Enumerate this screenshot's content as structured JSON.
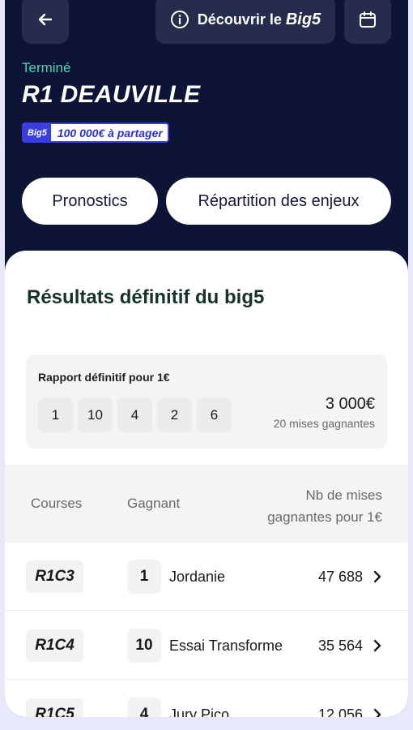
{
  "header": {
    "discover_label": "Découvrir le",
    "discover_brand": "Big5",
    "status": "Terminé",
    "race_title": "R1 DEAUVILLE",
    "jackpot_logo": "Big5",
    "jackpot_amount": "100 000€ à partager"
  },
  "tabs": [
    {
      "label": "Pronostics"
    },
    {
      "label": "Répartition des enjeux"
    }
  ],
  "results": {
    "title": "Résultats définitif du big5",
    "report_label": "Rapport définitif pour 1€",
    "numbers": [
      "1",
      "10",
      "4",
      "2",
      "6"
    ],
    "amount": "3 000€",
    "winning_bets": "20 mises gagnantes"
  },
  "table": {
    "col_courses": "Courses",
    "col_gagnant": "Gagnant",
    "col_mises_line1": "Nb de mises",
    "col_mises_line2": "gagnantes pour 1€",
    "rows": [
      {
        "course": "R1C3",
        "num": "1",
        "horse": "Jordanie",
        "mises": "47 688"
      },
      {
        "course": "R1C4",
        "num": "10",
        "horse": "Essai Transforme",
        "mises": "35 564"
      },
      {
        "course": "R1C5",
        "num": "4",
        "horse": "Jury Pico",
        "mises": "12 056"
      }
    ]
  },
  "icons": {
    "back": "arrow-left-icon",
    "info": "info-circle-icon",
    "calendar": "calendar-icon",
    "chevron": "chevron-right-icon"
  },
  "colors": {
    "header_bg": "#0d1436",
    "status": "#4fd6b0",
    "brand_blue": "#3a3ee0"
  }
}
